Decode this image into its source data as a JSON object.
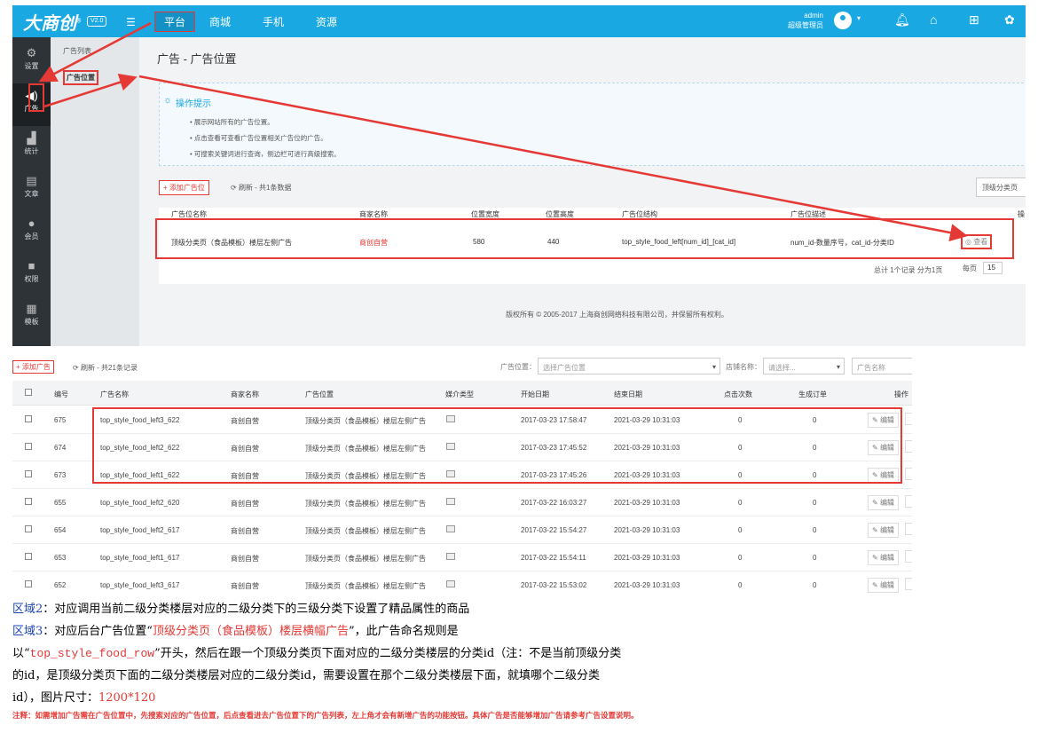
{
  "app": {
    "logo": "大商创",
    "logo_mark": "®",
    "version": "V2.0",
    "menu_icon": "list-icon"
  },
  "top_nav": [
    "平台",
    "商城",
    "手机",
    "资源"
  ],
  "admin": {
    "name": "admin",
    "role": "超级管理员",
    "caret": "▾"
  },
  "top_icons": [
    "bell-icon",
    "home-icon",
    "sitemap-icon",
    "palette-icon"
  ],
  "sidebar": {
    "items": [
      {
        "label": "设置",
        "icon": "gear-icon"
      },
      {
        "label": "广告",
        "icon": "speaker-icon"
      },
      {
        "label": "统计",
        "icon": "chart-icon"
      },
      {
        "label": "文章",
        "icon": "document-icon"
      },
      {
        "label": "会员",
        "icon": "user-icon"
      },
      {
        "label": "权限",
        "icon": "lock-icon"
      },
      {
        "label": "模板",
        "icon": "grid-icon"
      }
    ]
  },
  "subnav": {
    "items": [
      "广告列表",
      "广告位置"
    ]
  },
  "page": {
    "title": "广告 - 广告位置"
  },
  "tips": {
    "title": "操作提示",
    "items": [
      "展示网站所有的广告位置。",
      "点击查看可查看广告位置相关广告位的广告。",
      "可搜索关键词进行查询，侧边栏可进行高级搜索。"
    ]
  },
  "toolbar1": {
    "add_label": "+ 添加广告位",
    "refresh_label": "刷新 - 共1条数据",
    "filter": "顶级分类页"
  },
  "table1": {
    "headers": [
      "广告位名称",
      "商家名称",
      "位置宽度",
      "位置高度",
      "广告位结构",
      "广告位描述",
      "操"
    ],
    "row": [
      "顶级分类页（食品模板）楼层左侧广告",
      "商创自营",
      "580",
      "440",
      "top_style_food_left[num_id]_[cat_id]",
      "num_id-数量序号，cat_id-分类ID"
    ],
    "view_label": "查看"
  },
  "pager1": {
    "total": "总计 1个记录 分为1页",
    "per_page_label": "每页",
    "per_page": "15"
  },
  "footer": {
    "copyright": "版权所有 © 2005-2017 上海商创网络科技有限公司，并保留所有权利。"
  },
  "toolbar2": {
    "add_label": "+ 添加广告",
    "refresh_label": "刷新 - 共21条记录",
    "pos_label": "广告位置：",
    "pos_placeholder": "选择广告位置",
    "shop_label": "店铺名称：",
    "shop_placeholder": "请选择...",
    "name_placeholder": "广告名称"
  },
  "table2": {
    "headers": [
      "编号",
      "广告名称",
      "商家名称",
      "广告位置",
      "媒介类型",
      "开始日期",
      "结束日期",
      "点击次数",
      "生成订单",
      "操作"
    ],
    "edit_label": "编辑",
    "rows": [
      [
        "675",
        "top_style_food_left3_622",
        "商创自营",
        "顶级分类页（食品模板）楼层左侧广告",
        "2017-03-23 17:58:47",
        "2021-03-29 10:31:03",
        "0",
        "0"
      ],
      [
        "674",
        "top_style_food_left2_622",
        "商创自营",
        "顶级分类页（食品模板）楼层左侧广告",
        "2017-03-23 17:45:52",
        "2021-03-29 10:31:03",
        "0",
        "0"
      ],
      [
        "673",
        "top_style_food_left1_622",
        "商创自营",
        "顶级分类页（食品模板）楼层左侧广告",
        "2017-03-23 17:45:26",
        "2021-03-29 10:31:03",
        "0",
        "0"
      ],
      [
        "655",
        "top_style_food_left2_620",
        "商创自营",
        "顶级分类页（食品模板）楼层左侧广告",
        "2017-03-22 16:03:27",
        "2021-03-29 10:31:03",
        "0",
        "0"
      ],
      [
        "654",
        "top_style_food_left2_617",
        "商创自营",
        "顶级分类页（食品模板）楼层左侧广告",
        "2017-03-22 15:54:27",
        "2021-03-29 10:31:03",
        "0",
        "0"
      ],
      [
        "653",
        "top_style_food_left1_617",
        "商创自营",
        "顶级分类页（食品模板）楼层左侧广告",
        "2017-03-22 15:54:11",
        "2021-03-29 10:31:03",
        "0",
        "0"
      ],
      [
        "652",
        "top_style_food_left3_617",
        "商创自营",
        "顶级分类页（食品模板）楼层左侧广告",
        "2017-03-22 15:53:02",
        "2021-03-29 10:31:03",
        "0",
        "0"
      ]
    ]
  },
  "notes": {
    "zone2_label": "区域2",
    "zone2_text": "：对应调用当前二级分类楼层对应的二级分类下的三级分类下设置了精品属性的商品",
    "zone3_label": "区域3",
    "zone3_a": "：对应后台广告位置“",
    "zone3_red": "顶级分类页（食品模板）楼层横幅广告",
    "zone3_b": "”，此广告命名规则是",
    "line3_a": "以“",
    "line3_mono": "top_style_food_row",
    "line3_b": "”开头，然后在跟一个顶级分类页下面对应的二级分类楼层的分类id（注：不是当前顶级分类",
    "line4": "的id，是顶级分类页下面的二级分类楼层对应的二级分类id，需要设置在那个二级分类楼层下面，就填哪个二级分类",
    "line5_a": "id），图片尺寸：",
    "line5_red": "1200*120",
    "footnote": "注释：如需增加广告需在广告位置中，先搜索对应的广告位置，后点查看进去广告位置下的广告列表，左上角才会有新增广告的功能按钮。具体广告是否能够增加广告请参考广告设置说明。"
  },
  "colors": {
    "topbar": "#1aa8e3",
    "sidebar": "#2e3338",
    "highlight": "#e53935",
    "zone_label": "#1a44b8"
  }
}
